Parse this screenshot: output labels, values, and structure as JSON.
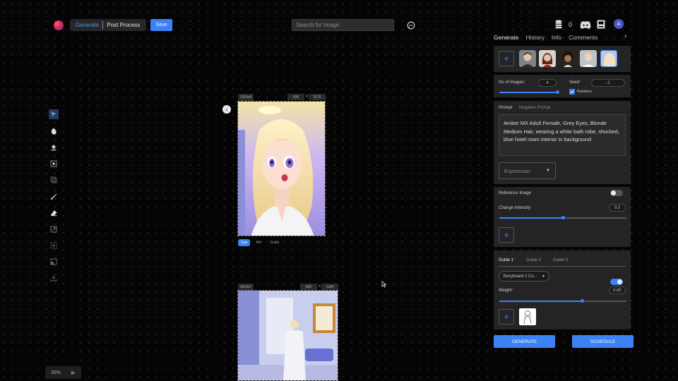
{
  "header": {
    "mode_generate": "Generate",
    "mode_postprocess": "Post Process",
    "save_label": "Save",
    "search_placeholder": "Search for Image",
    "credits": "0",
    "avatar_initial": "A"
  },
  "toolbar_icons": [
    "cursor-icon",
    "hand-icon",
    "upload-icon",
    "select-region-icon",
    "layers-icon",
    "brush-icon",
    "eraser-icon",
    "resize-icon",
    "expand-icon",
    "mask-icon",
    "download-icon"
  ],
  "canvas": {
    "image1": {
      "label": "GENe8",
      "width": "696",
      "height": "1076",
      "tabs": [
        "Gen",
        "Ref",
        "Guide"
      ],
      "active_tab": "Gen"
    },
    "image2": {
      "label": "GENe7",
      "width": "800",
      "height": "1184"
    },
    "zoom": "36%"
  },
  "panel": {
    "tabs": [
      "Generate",
      "History",
      "Info",
      "Comments"
    ],
    "num_images_label": "No of Images",
    "num_images_value": "4",
    "num_images_level": 1.0,
    "seed_label": "Seed",
    "seed_value": "-1",
    "random_label": "Random",
    "random_checked": true,
    "prompt_tab": "Prompt",
    "negative_prompt_tab": "Negative Prompt",
    "prompt_text": "Amber MX Adult Female, Grey Eyes, Blonde Medium Hair, wearing a white bath robe, shocked, blue hotel room interior in background",
    "expression_placeholder": "Expression",
    "reference_image_label": "Reference Image",
    "reference_image_enabled": false,
    "change_intensity_label": "Change Intensity",
    "change_intensity_value": "0.5",
    "guide_tabs": [
      "Guide 1",
      "Guide 2",
      "Guide 3"
    ],
    "guide_select": "Storyboard 2 Co...",
    "guide_enabled": true,
    "weight_label": "Weight",
    "weight_value": "0.65",
    "generate_label": "GENERATE",
    "schedule_label": "SCHEDULE"
  },
  "colors": {
    "accent": "#3b82f6",
    "required": "#e0443e",
    "background": "#050505"
  }
}
